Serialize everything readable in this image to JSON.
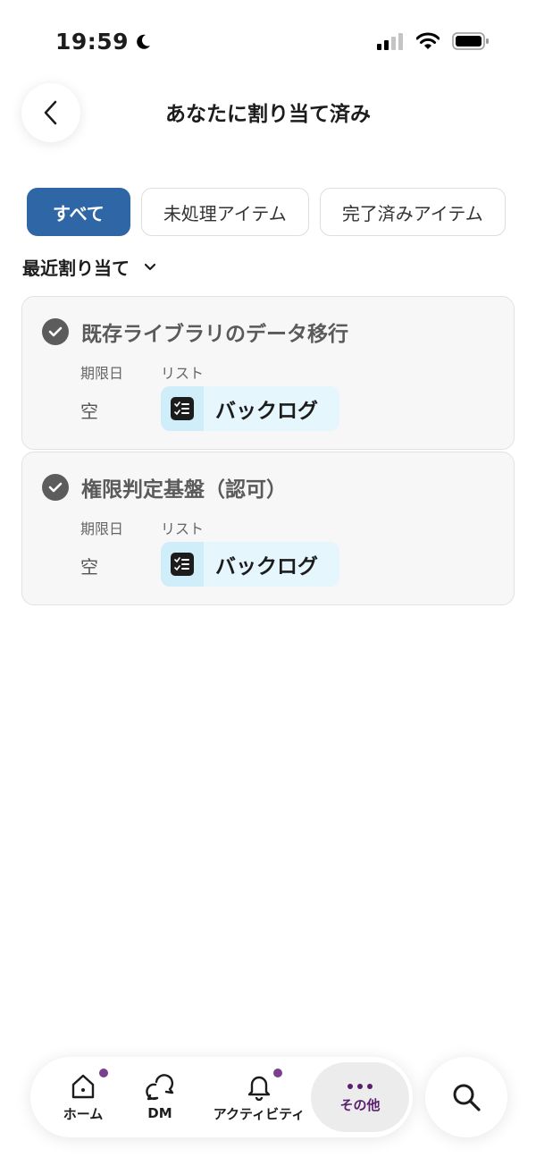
{
  "status_bar": {
    "time": "19:59"
  },
  "header": {
    "title": "あなたに割り当て済み"
  },
  "filters": [
    {
      "label": "すべて",
      "active": true
    },
    {
      "label": "未処理アイテム",
      "active": false
    },
    {
      "label": "完了済みアイテム",
      "active": false
    }
  ],
  "sort": {
    "label": "最近割り当て"
  },
  "tasks": [
    {
      "title": "既存ライブラリのデータ移行",
      "due_label": "期限日",
      "due_value": "空",
      "list_label": "リスト",
      "list_name": "バックログ"
    },
    {
      "title": "権限判定基盤（認可）",
      "due_label": "期限日",
      "due_value": "空",
      "list_label": "リスト",
      "list_name": "バックログ"
    }
  ],
  "nav": {
    "home": "ホーム",
    "dm": "DM",
    "activity": "アクティビティ",
    "more": "その他"
  },
  "colors": {
    "accent": "#2f67a6",
    "notification_dot": "#7b3f8f",
    "more_label": "#5a1f6e"
  }
}
